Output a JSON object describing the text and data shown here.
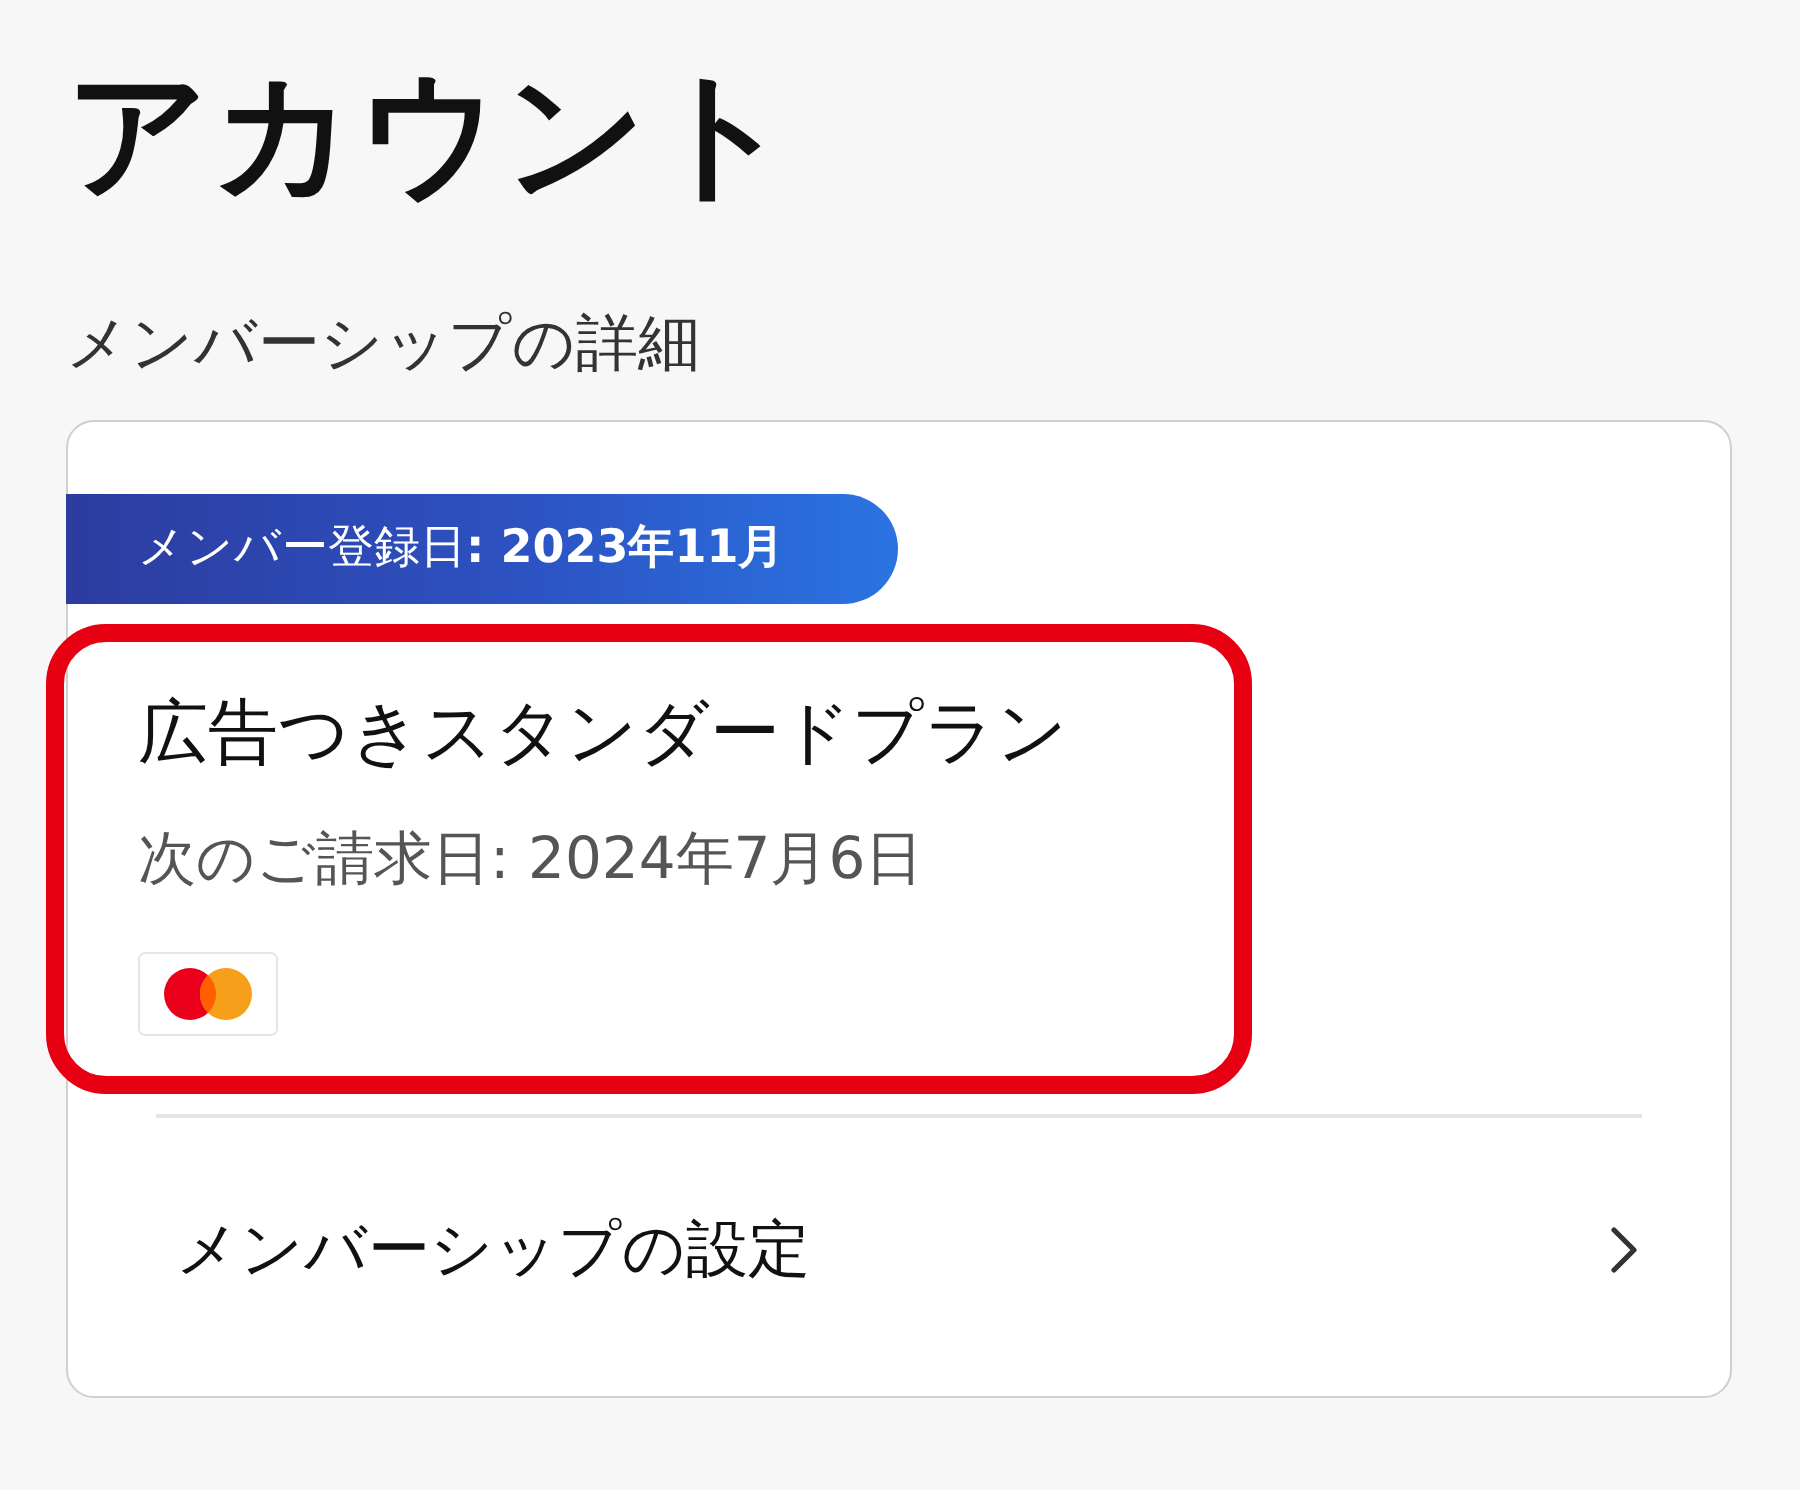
{
  "page": {
    "title": "アカウント"
  },
  "membership": {
    "heading": "メンバーシップの詳細",
    "badge": "メンバー登録日**: 2023年11月**",
    "plan": {
      "name": "広告つきスタンダードプラン",
      "next_billing": "次のご請求日: 2024年7月6日",
      "highlighted": true,
      "payment_method": {
        "kind": "mastercard"
      }
    },
    "settings_link": {
      "label": "メンバーシップの設定"
    }
  }
}
